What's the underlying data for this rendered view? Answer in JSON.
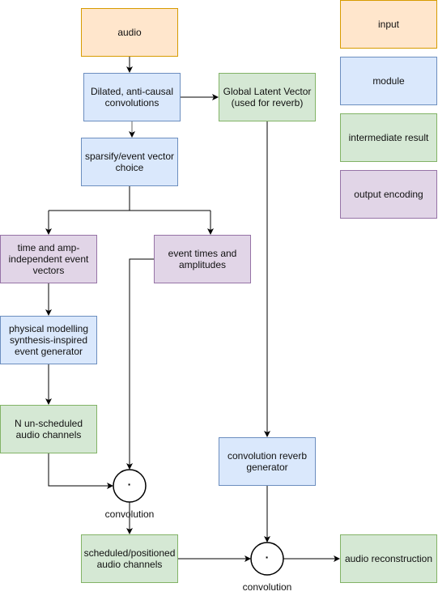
{
  "nodes": {
    "audio": "audio",
    "dilated": "Dilated, anti-causal convolutions",
    "global": "Global Latent Vector (used for reverb)",
    "sparsify": "sparsify/event vector choice",
    "time_amp": "time and amp-independent event vectors",
    "event_times": "event times and amplitudes",
    "physical": "physical modelling synthesis-inspired event generator",
    "unscheduled": "N un-scheduled audio channels",
    "conv1_symbol": "·",
    "conv1_label": "convolution",
    "scheduled": "scheduled/positioned audio channels",
    "reverb_gen": "convolution reverb generator",
    "conv2_symbol": "·",
    "conv2_label": "convolution",
    "reconstruction": "audio reconstruction"
  },
  "legend": {
    "input": "input",
    "module": "module",
    "intermediate": "intermediate result",
    "output": "output encoding"
  },
  "colors": {
    "input": "#ffe6cc",
    "module": "#dae8fc",
    "intermediate": "#d5e8d4",
    "output": "#e1d5e7"
  }
}
